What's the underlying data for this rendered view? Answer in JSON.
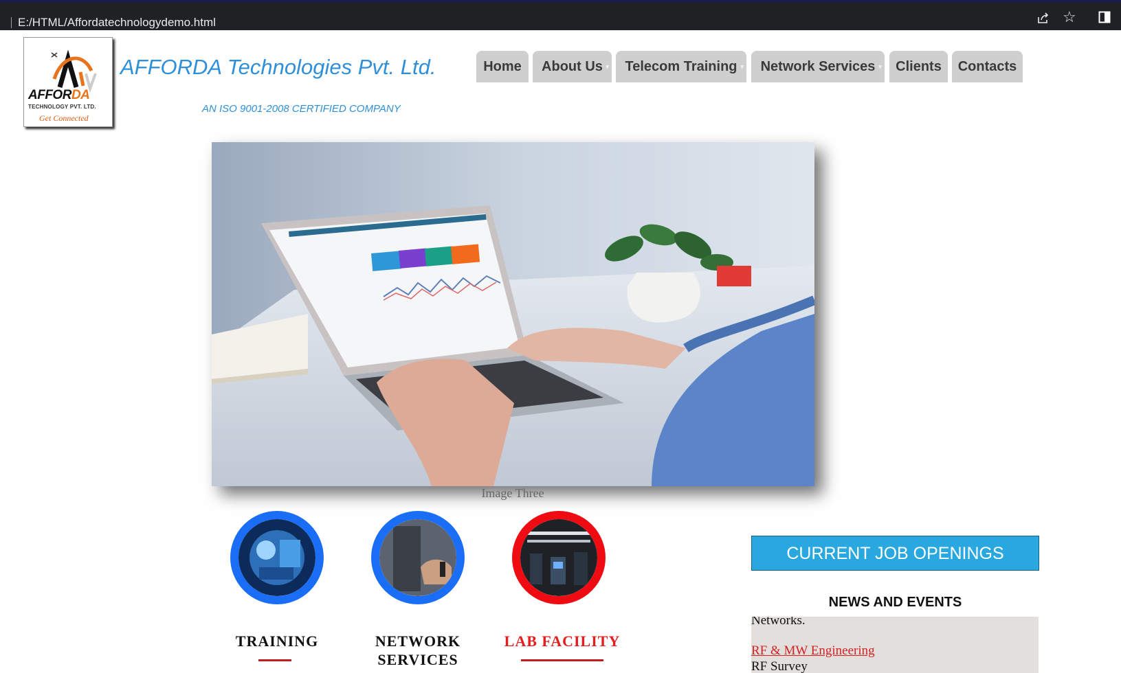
{
  "browser": {
    "url": "E:/HTML/Affordatechnologydemo.html",
    "icons": [
      "share-icon",
      "star-icon",
      "side-panel-icon"
    ]
  },
  "header": {
    "logo_word_a": "AFFOR",
    "logo_word_b": "DA",
    "logo_sub": "TECHNOLOGY PVT. LTD.",
    "logo_tag": "Get Connected",
    "company_name": "AFFORDA Technologies Pvt. Ltd.",
    "tagline": "AN ISO 9001-2008 CERTIFIED COMPANY"
  },
  "nav": [
    {
      "label": "Home",
      "dropdown": false
    },
    {
      "label": "About Us",
      "dropdown": true
    },
    {
      "label": "Telecom Training",
      "dropdown": true
    },
    {
      "label": "Network Services",
      "dropdown": true
    },
    {
      "label": "Clients",
      "dropdown": false
    },
    {
      "label": "Contacts",
      "dropdown": false
    }
  ],
  "nav_dropdown_glyph": "▾",
  "slideshow": {
    "caption": "Image Three"
  },
  "features": [
    {
      "label_line1": "TRAINING",
      "label_line2": "",
      "ring_color": "#1a6ef5"
    },
    {
      "label_line1": "NETWORK",
      "label_line2": "SERVICES",
      "ring_color": "#1a6ef5"
    },
    {
      "label_line1": "LAB FACILITY",
      "label_line2": "",
      "ring_color": "#ee0c12"
    }
  ],
  "sidebar": {
    "jobs_button": "CURRENT JOB OPENINGS",
    "news_title": "NEWS AND EVENTS",
    "news_line1": "Networks.",
    "news_link": "RF & MW Engineering",
    "news_line3": "RF Survey"
  },
  "colors": {
    "brand_blue": "#2f8fd8",
    "nav_bg": "#cfcfcf",
    "jobs_bg": "#29a8e0",
    "accent_red": "#e41d1d"
  }
}
